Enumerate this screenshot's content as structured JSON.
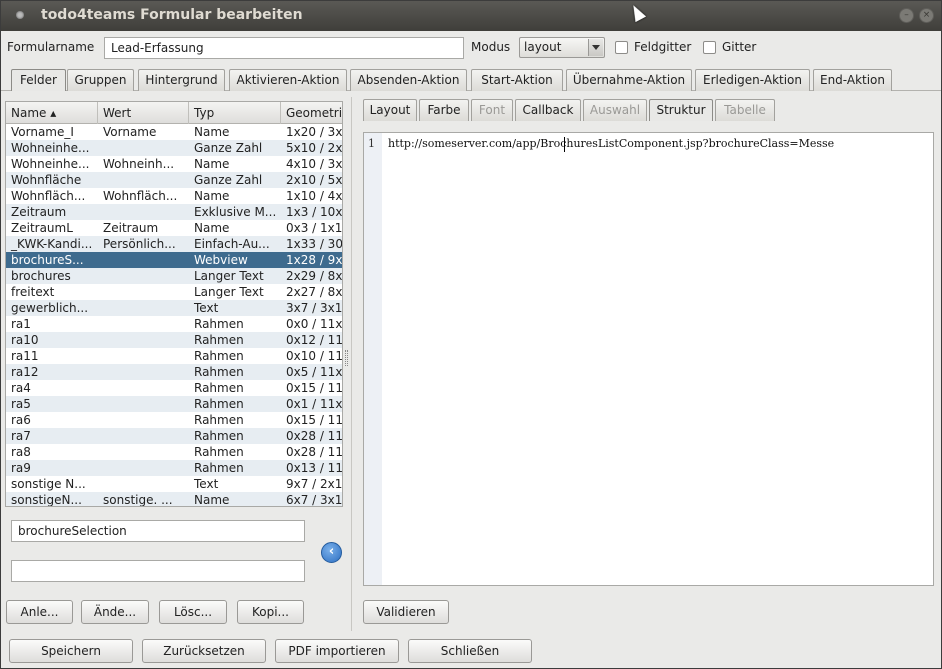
{
  "window": {
    "title": "todo4teams Formular bearbeiten"
  },
  "form": {
    "name_label": "Formularname",
    "name_value": "Lead-Erfassung",
    "modus_label": "Modus",
    "modus_value": "layout",
    "feldgitter_label": "Feldgitter",
    "gitter_label": "Gitter"
  },
  "tabs": [
    "Felder",
    "Gruppen",
    "Hintergrund",
    "Aktivieren-Aktion",
    "Absenden-Aktion",
    "Start-Aktion",
    "Übernahme-Aktion",
    "Erledigen-Aktion",
    "End-Aktion"
  ],
  "table": {
    "headers": [
      "Name ▴",
      "Wert",
      "Typ",
      "Geometri"
    ],
    "rows": [
      [
        "Vorname_I",
        "Vorname",
        "Name",
        "1x20 / 3x"
      ],
      [
        "Wohneinhe...",
        "",
        "Ganze Zahl",
        "5x10 / 2x"
      ],
      [
        "Wohneinhe...",
        "Wohneinh...",
        "Name",
        "4x10 / 3x"
      ],
      [
        "Wohnfläche",
        "",
        "Ganze Zahl",
        "2x10 / 5x"
      ],
      [
        "Wohnfläch...",
        "Wohnfläch...",
        "Name",
        "1x10 / 4x"
      ],
      [
        "Zeitraum",
        "",
        "Exklusive M...",
        "1x3 / 10x"
      ],
      [
        "ZeitraumL",
        "Zeitraum",
        "Name",
        "0x3 / 1x1"
      ],
      [
        "_KWK-Kandi...",
        "Persönlich...",
        "Einfach-Au...",
        "1x33 / 30"
      ],
      [
        "brochureS...",
        "",
        "Webview",
        "1x28 / 9x"
      ],
      [
        "brochures",
        "",
        "Langer Text",
        "2x29 / 8x"
      ],
      [
        "freitext",
        "",
        "Langer Text",
        "2x27 / 8x"
      ],
      [
        "gewerblich...",
        "",
        "Text",
        "3x7 / 3x1"
      ],
      [
        "ra1",
        "",
        "Rahmen",
        "0x0 / 11x"
      ],
      [
        "ra10",
        "",
        "Rahmen",
        "0x12 / 11"
      ],
      [
        "ra11",
        "",
        "Rahmen",
        "0x10 / 11"
      ],
      [
        "ra12",
        "",
        "Rahmen",
        "0x5 / 11x"
      ],
      [
        "ra4",
        "",
        "Rahmen",
        "0x15 / 11"
      ],
      [
        "ra5",
        "",
        "Rahmen",
        "0x1 / 11x"
      ],
      [
        "ra6",
        "",
        "Rahmen",
        "0x15 / 11"
      ],
      [
        "ra7",
        "",
        "Rahmen",
        "0x28 / 11"
      ],
      [
        "ra8",
        "",
        "Rahmen",
        "0x28 / 11"
      ],
      [
        "ra9",
        "",
        "Rahmen",
        "0x13 / 11"
      ],
      [
        "sonstige N...",
        "",
        "Text",
        "9x7 / 2x1"
      ],
      [
        "sonstigeN...",
        "sonstige. ...",
        "Name",
        "6x7 / 3x1"
      ]
    ],
    "selected_row": 8
  },
  "left_fields": {
    "name_value": "brochureSelection",
    "second_value": ""
  },
  "left_buttons": [
    "Anle...",
    "Ände...",
    "Lösc...",
    "Kopi..."
  ],
  "subtabs": [
    {
      "label": "Layout",
      "enabled": true
    },
    {
      "label": "Farbe",
      "enabled": true
    },
    {
      "label": "Font",
      "enabled": false
    },
    {
      "label": "Callback",
      "enabled": true
    },
    {
      "label": "Auswahl",
      "enabled": false
    },
    {
      "label": "Struktur",
      "enabled": true
    },
    {
      "label": "Tabelle",
      "enabled": false
    }
  ],
  "editor": {
    "line_number": "1",
    "code": "http://someserver.com/app/BrochuresListComponent.jsp?brochureClass=Messe"
  },
  "validate_label": "Validieren",
  "bottom_buttons": [
    "Speichern",
    "Zurücksetzen",
    "PDF importieren",
    "Schließen"
  ]
}
